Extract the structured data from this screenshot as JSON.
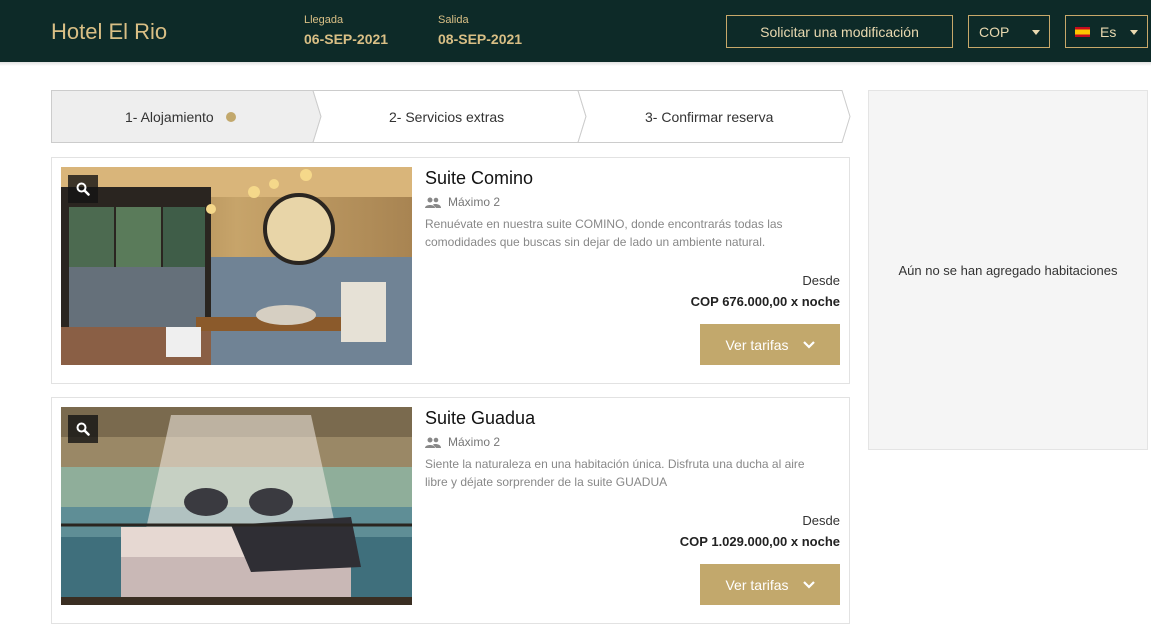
{
  "header": {
    "hotel_name": "Hotel El Rio",
    "arrival_label": "Llegada",
    "arrival_date": "06-SEP-2021",
    "departure_label": "Salida",
    "departure_date": "08-SEP-2021",
    "modify_button": "Solicitar una modificación",
    "currency": "COP",
    "language": "Es"
  },
  "steps": [
    {
      "label": "1- Alojamiento",
      "active": true
    },
    {
      "label": "2- Servicios extras",
      "active": false
    },
    {
      "label": "3- Confirmar reserva",
      "active": false
    }
  ],
  "rooms": [
    {
      "name": "Suite Comino",
      "capacity": "Máximo 2",
      "description": "Renuévate en nuestra suite COMINO, donde encontrarás todas las comodidades que buscas sin dejar de lado un ambiente natural.",
      "from_label": "Desde",
      "price": "COP 676.000,00 x noche",
      "rates_button": "Ver tarifas"
    },
    {
      "name": "Suite Guadua",
      "capacity": "Máximo 2",
      "description": "Siente la naturaleza en una habitación única. Disfruta una ducha al aire libre y déjate sorprender de la suite GUADUA",
      "from_label": "Desde",
      "price": "COP 1.029.000,00 x noche",
      "rates_button": "Ver tarifas"
    }
  ],
  "sidebar": {
    "empty_text": "Aún no se han agregado habitaciones"
  },
  "colors": {
    "header_bg": "#0d2a28",
    "gold": "#c2a86c",
    "gold_text": "#d9bf85"
  },
  "icons": [
    "search-icon",
    "users-icon",
    "chevron-down-icon",
    "caret-down-icon",
    "spain-flag-icon"
  ]
}
